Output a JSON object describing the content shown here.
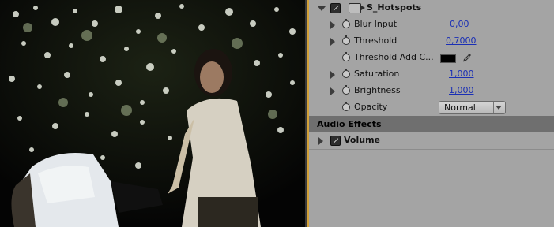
{
  "effect": {
    "name": "S_Hotspots",
    "params": [
      {
        "label": "Blur Input",
        "value": "0,00",
        "expandable": true
      },
      {
        "label": "Threshold",
        "value": "0,7000",
        "expandable": true
      },
      {
        "label": "Threshold Add C...",
        "value": "",
        "expandable": false,
        "color": "#000000"
      },
      {
        "label": "Saturation",
        "value": "1,000",
        "expandable": true
      },
      {
        "label": "Brightness",
        "value": "1,000",
        "expandable": true
      },
      {
        "label": "Opacity",
        "value": "Normal",
        "expandable": false
      }
    ]
  },
  "audio_effects": {
    "header": "Audio Effects",
    "items": [
      {
        "label": "Volume"
      }
    ]
  },
  "colors": {
    "accent_divider": "#d3a23a",
    "link_value": "#1a2fb5",
    "panel_bg": "#a4a4a4",
    "section_header_bg": "#6f6f6f"
  },
  "icons": {
    "effect_toggle": "fx-icon",
    "mask": "mask-icon",
    "stopwatch": "stopwatch-icon",
    "eyedropper": "eyedropper-icon",
    "expand": "triangle-right-icon",
    "collapse": "triangle-down-icon"
  }
}
